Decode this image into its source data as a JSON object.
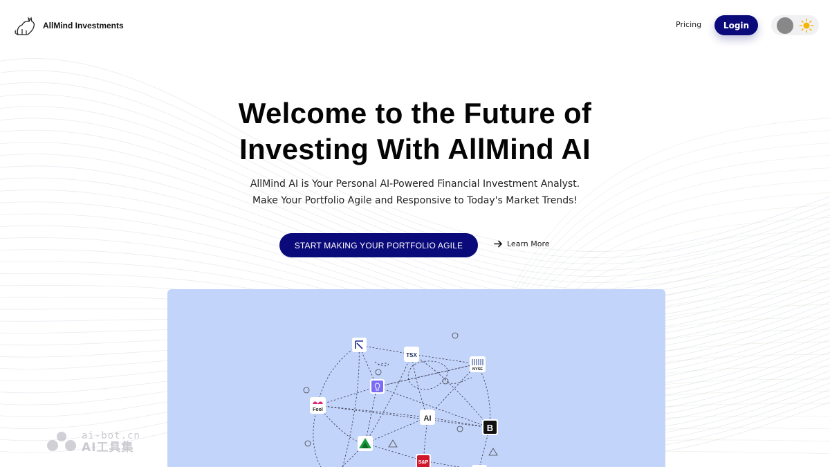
{
  "header": {
    "brand_name": "AllMind Investments",
    "nav_pricing": "Pricing",
    "login_label": "Login",
    "theme_toggle_icon": "sun-icon"
  },
  "hero": {
    "title_line1": "Welcome to the Future of",
    "title_line2": "Investing With AllMind AI",
    "subtitle_line1": "AllMind AI is Your Personal AI-Powered Financial Investment Analyst.",
    "subtitle_line2": "Make Your Portfolio Agile and Responsive to Today's Market Trends!",
    "cta_label": "START MAKING YOUR PORTFOLIO AGILE",
    "learn_more_label": "Learn More"
  },
  "preview": {
    "nodes": {
      "tsx": "TSX",
      "nyse": "NYSE",
      "fool": "Fool",
      "ai": "AI",
      "b": "B",
      "sp": "S&P"
    }
  },
  "watermark": {
    "line1": "ai-bot.cn",
    "line2": "AI工具集"
  },
  "colors": {
    "primary": "#0b0a7a",
    "panel_bg": "#c3d4fb",
    "text": "#050505"
  }
}
